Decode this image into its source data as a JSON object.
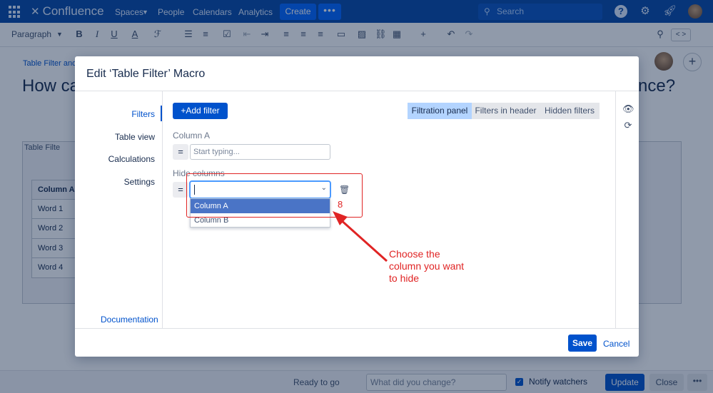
{
  "topnav": {
    "logo": "Confluence",
    "links": [
      "Spaces",
      "People",
      "Calendars",
      "Analytics"
    ],
    "create": "Create",
    "more": "•••",
    "search_placeholder": "Search"
  },
  "toolbar": {
    "paragraph": "Paragraph",
    "code_toggle": "< >"
  },
  "page": {
    "breadcrumb": "Table Filter and",
    "title_left": "How ca",
    "title_right": "nce?",
    "macro_label": "Table Filte",
    "table_rows": [
      "Column A",
      "Word 1",
      "Word 2",
      "Word 3",
      "Word 4"
    ]
  },
  "modal": {
    "title": "Edit ‘Table Filter’ Macro",
    "side_nav": [
      "Filters",
      "Table view",
      "Calculations",
      "Settings"
    ],
    "documentation": "Documentation",
    "add_filter": "+Add filter",
    "segments": [
      "Filtration panel",
      "Filters in header",
      "Hidden filters"
    ],
    "active_segment": "Filtration panel",
    "column_a_label": "Column A",
    "eq_symbol": "=",
    "column_a_placeholder": "Start typing...",
    "hide_columns_label": "Hide columns",
    "dropdown_options": [
      "Column A",
      "Column B"
    ],
    "highlighted_option": "Column A",
    "step_number": "8",
    "save": "Save",
    "cancel": "Cancel"
  },
  "annotation": {
    "text": "Choose the column you want to hide"
  },
  "bottombar": {
    "status": "Ready to go",
    "change_placeholder": "What did you change?",
    "notify": "Notify watchers",
    "update": "Update",
    "close": "Close",
    "more": "•••"
  },
  "colors": {
    "nav": "#0747A6",
    "accent": "#0052CC",
    "annotation": "#E02424"
  }
}
